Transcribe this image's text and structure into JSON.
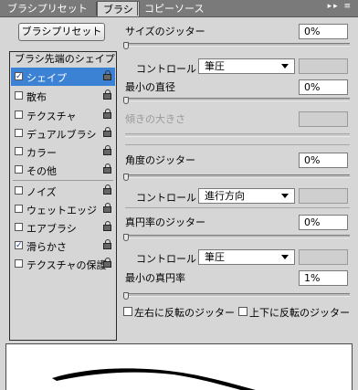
{
  "tabs": [
    {
      "label": "ブラシプリセット",
      "active": false
    },
    {
      "label": "ブラシ",
      "active": true
    },
    {
      "label": "コピーソース",
      "active": false
    }
  ],
  "tab_icons": "▸▸ ≡",
  "preset_button": "ブラシプリセット",
  "list": {
    "header": "ブラシ先端のシェイプ",
    "items": [
      {
        "label": "シェイプ",
        "checked": true,
        "selected": true
      },
      {
        "label": "散布",
        "checked": false
      },
      {
        "label": "テクスチャ",
        "checked": false
      },
      {
        "label": "デュアルブラシ",
        "checked": false
      },
      {
        "label": "カラー",
        "checked": false
      },
      {
        "label": "その他",
        "checked": false
      },
      {
        "label": "ノイズ",
        "checked": false
      },
      {
        "label": "ウェットエッジ",
        "checked": false
      },
      {
        "label": "エアブラシ",
        "checked": false
      },
      {
        "label": "滑らかさ",
        "checked": true
      },
      {
        "label": "テクスチャの保護",
        "checked": false
      }
    ]
  },
  "controls": {
    "size_jitter": {
      "label": "サイズのジッター",
      "value": "0%"
    },
    "control1": {
      "label": "コントロール：",
      "value": "筆圧"
    },
    "min_diameter": {
      "label": "最小の直径",
      "value": "0%"
    },
    "tilt_scale": {
      "label": "傾きの大きさ",
      "value": ""
    },
    "angle_jitter": {
      "label": "角度のジッター",
      "value": "0%"
    },
    "control2": {
      "label": "コントロール：",
      "value": "進行方向"
    },
    "roundness_jitter": {
      "label": "真円率のジッター",
      "value": "0%"
    },
    "control3": {
      "label": "コントロール：",
      "value": "筆圧"
    },
    "min_roundness": {
      "label": "最小の真円率",
      "value": "1%"
    },
    "flip_x": {
      "label": "左右に反転のジッター"
    },
    "flip_y": {
      "label": "上下に反転のジッター"
    }
  },
  "colors": {
    "selection": "#3b82d4",
    "panel": "#d6d6d6"
  }
}
